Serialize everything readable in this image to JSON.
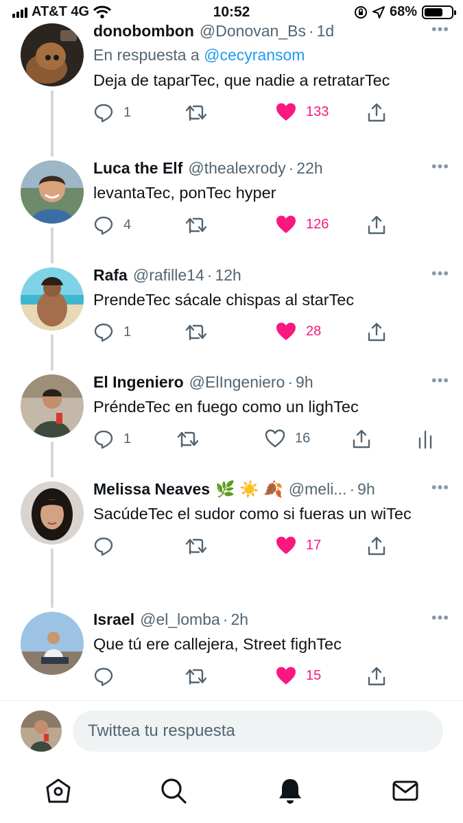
{
  "status_bar": {
    "carrier": "AT&T 4G",
    "time": "10:52",
    "battery": "68%",
    "battery_level": 0.68
  },
  "tweets": [
    {
      "name": "donobombon",
      "handle": "@Donovan_Bs",
      "time": "1d",
      "reply_prefix": "En respuesta a",
      "reply_to": "@cecyransom",
      "text": "Deja de taparTec, que nadie a retratarTec",
      "replies": "1",
      "retweets": "",
      "likes": "133",
      "liked": true
    },
    {
      "name": "Luca the Elf",
      "handle": "@thealexrody",
      "time": "22h",
      "text": "levantaTec, ponTec hyper",
      "replies": "4",
      "retweets": "",
      "likes": "126",
      "liked": true
    },
    {
      "name": "Rafa",
      "handle": "@rafille14",
      "time": "12h",
      "text": "PrendeTec sácale chispas al starTec",
      "replies": "1",
      "retweets": "",
      "likes": "28",
      "liked": true
    },
    {
      "name": "El Ingeniero",
      "handle": "@ElIngeniero",
      "time": "9h",
      "text": "PréndeTec en fuego como un lighTec",
      "replies": "1",
      "retweets": "",
      "likes": "16",
      "liked": false
    },
    {
      "name": "Melissa Neaves",
      "emojis": "🌿 ☀️ 🍂",
      "handle": "@meli...",
      "time": "9h",
      "text": "SacúdeTec el sudor como si fueras un wiTec",
      "replies": "",
      "retweets": "",
      "likes": "17",
      "liked": true
    },
    {
      "name": "Israel",
      "handle": "@el_lomba",
      "time": "2h",
      "text": "Que tú ere callejera, Street fighTec",
      "replies": "",
      "retweets": "",
      "likes": "15",
      "liked": true
    }
  ],
  "composer": {
    "placeholder": "Twittea tu respuesta"
  },
  "tab_bar": [
    "home-icon",
    "search-icon",
    "notifications-icon",
    "messages-icon"
  ],
  "colors": {
    "like": "#f91880",
    "link": "#1d9bf0",
    "muted": "#536471",
    "thread": "#cfd9de"
  }
}
